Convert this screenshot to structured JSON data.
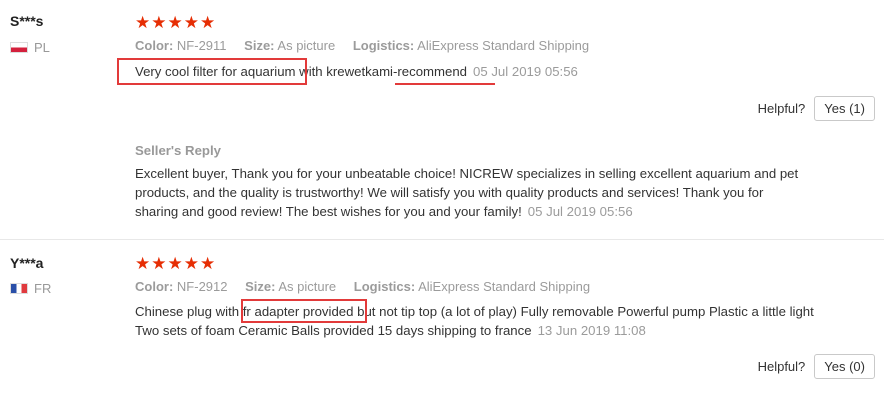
{
  "reviews": [
    {
      "user": "S***s",
      "country": "PL",
      "stars": "★★★★★",
      "color_label": "Color:",
      "color": "NF-2911",
      "size_label": "Size:",
      "size": "As picture",
      "logistics_label": "Logistics:",
      "logistics": "AliExpress Standard Shipping",
      "text": "Very cool filter for aquarium with krewetkami-recommend",
      "date": "05 Jul 2019 05:56",
      "helpful_label": "Helpful?",
      "yes_button": "Yes (1)"
    },
    {
      "user": "Y***a",
      "country": "FR",
      "stars": "★★★★★",
      "color_label": "Color:",
      "color": "NF-2912",
      "size_label": "Size:",
      "size": "As picture",
      "logistics_label": "Logistics:",
      "logistics": "AliExpress Standard Shipping",
      "text_line1": "Chinese plug with fr adapter provided but not tip top (a lot of play) Fully removable Powerful pump Plastic a little light",
      "text_line2": "Two sets of foam Ceramic Balls provided 15 days shipping to france",
      "date": "13 Jun 2019 11:08",
      "helpful_label": "Helpful?",
      "yes_button": "Yes (0)"
    }
  ],
  "seller_reply": {
    "title": "Seller's Reply",
    "line1": "Excellent buyer, Thank you for your unbeatable choice! NICREW specializes in selling excellent aquarium and pet",
    "line2": "products, and the quality is trustworthy! We will satisfy you with quality products and services! Thank you for",
    "line3": "sharing and good review! The best wishes for you and your family!",
    "date": "05 Jul 2019 05:56"
  },
  "colors": {
    "star": "#e62e04",
    "highlight": "#e23a3a",
    "meta_gray": "#9b9b9b"
  }
}
